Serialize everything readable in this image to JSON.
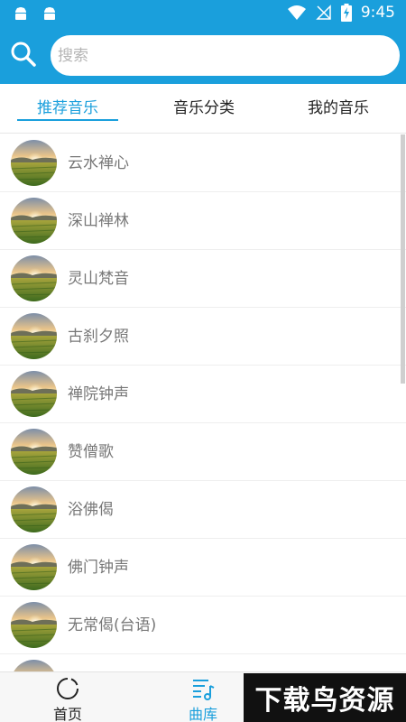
{
  "statusbar": {
    "time": "9:45"
  },
  "search": {
    "placeholder": "搜索"
  },
  "tabs": [
    {
      "label": "推荐音乐",
      "active": true
    },
    {
      "label": "音乐分类",
      "active": false
    },
    {
      "label": "我的音乐",
      "active": false
    }
  ],
  "songs": [
    {
      "title": "云水禅心"
    },
    {
      "title": "深山禅林"
    },
    {
      "title": "灵山梵音"
    },
    {
      "title": "古刹夕照"
    },
    {
      "title": "禅院钟声"
    },
    {
      "title": "赞僧歌"
    },
    {
      "title": "浴佛偈"
    },
    {
      "title": "佛门钟声"
    },
    {
      "title": "无常偈(台语)"
    },
    {
      "title": ""
    }
  ],
  "nav": {
    "home": {
      "label": "首页"
    },
    "library": {
      "label": "曲库"
    }
  },
  "watermark": {
    "text": "下载鸟资源"
  },
  "colors": {
    "accent": "#1a9fdc"
  }
}
